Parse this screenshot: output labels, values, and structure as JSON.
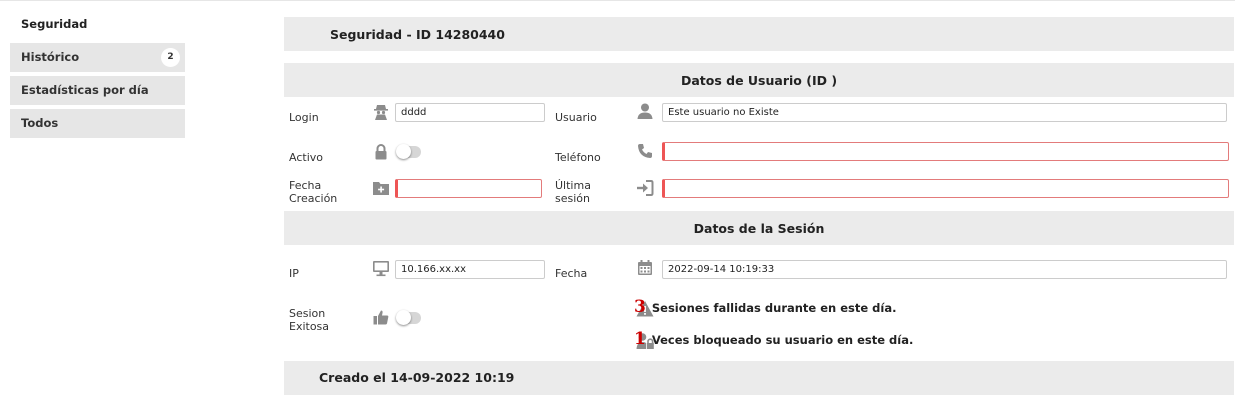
{
  "sidebar": {
    "items": [
      {
        "label": "Seguridad"
      },
      {
        "label": "Histórico",
        "badge": "2"
      },
      {
        "label": "Estadísticas por día"
      },
      {
        "label": "Todos"
      }
    ]
  },
  "header": {
    "title": "Seguridad - ID 14280440"
  },
  "user_section": {
    "title": "Datos de Usuario (ID )",
    "login_label": "Login",
    "login_value": "dddd",
    "usuario_label": "Usuario",
    "usuario_value": "Este usuario no Existe",
    "activo_label": "Activo",
    "telefono_label": "Teléfono",
    "telefono_value": "",
    "fecha_creacion_label_1": "Fecha",
    "fecha_creacion_label_2": "Creación",
    "fecha_creacion_value": "",
    "ultima_sesion_label_1": "Última",
    "ultima_sesion_label_2": "sesión",
    "ultima_sesion_value": ""
  },
  "session_section": {
    "title": "Datos de la Sesión",
    "ip_label": "IP",
    "ip_value": "10.166.xx.xx",
    "fecha_label": "Fecha",
    "fecha_value": "2022-09-14 10:19:33",
    "sesion_exitosa_label_1": "Sesion",
    "sesion_exitosa_label_2": "Exitosa",
    "failed_count": "3",
    "failed_text": "Sesiones fallidas durante en este día.",
    "blocked_count": "1",
    "blocked_text": "Veces bloqueado su usuario en este día."
  },
  "footer": {
    "created_text": "Creado el 14-09-2022 10:19"
  },
  "colors": {
    "accent_red": "#cc0000",
    "error_border": "#e55555",
    "panel_bg": "#ebebeb",
    "icon_gray": "#8c8c8c"
  }
}
